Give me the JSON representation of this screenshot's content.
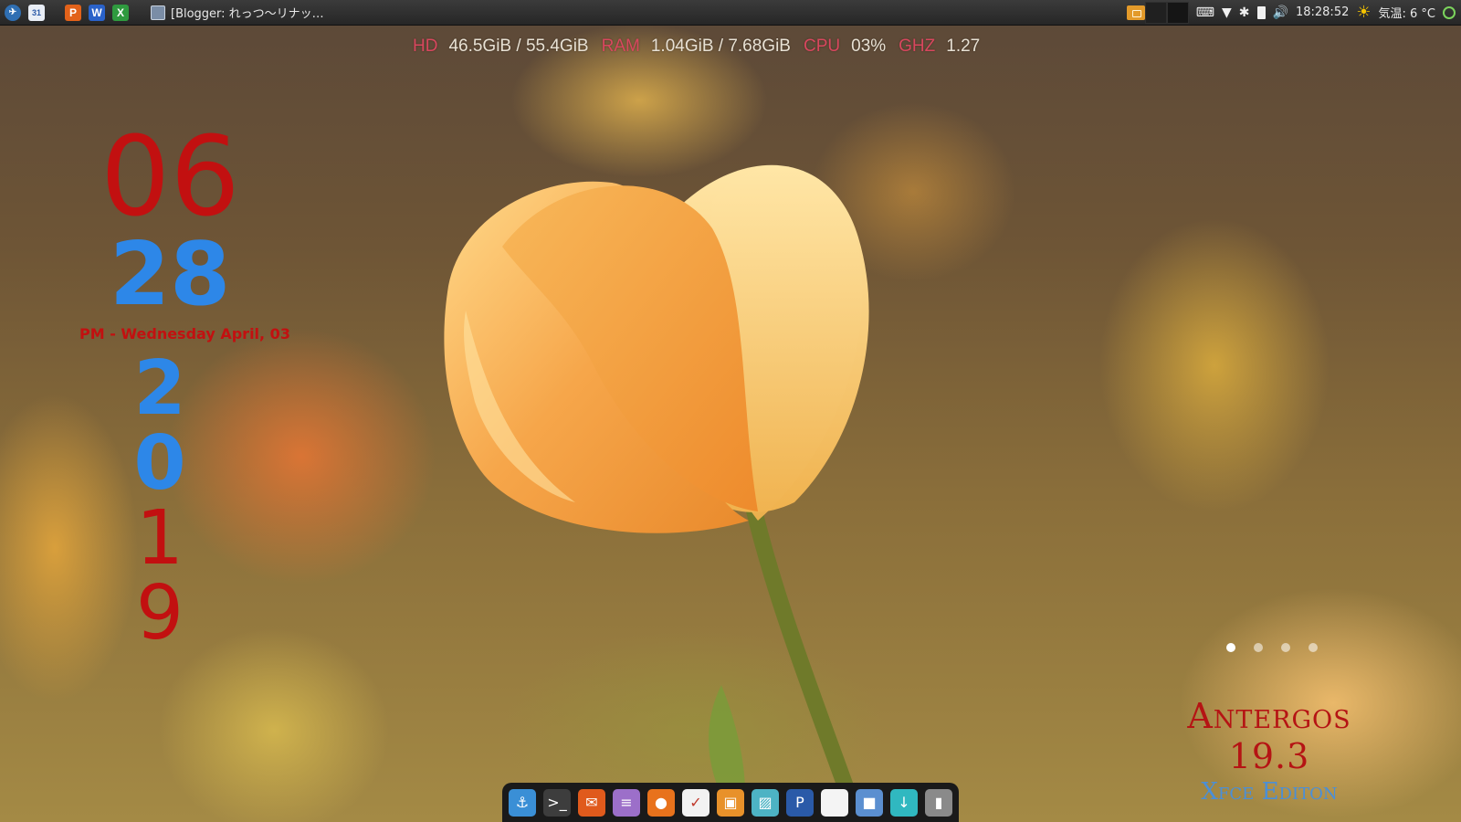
{
  "top_panel": {
    "launchers": [
      {
        "icon": "antergos-menu-icon",
        "glyph": "✈"
      },
      {
        "icon": "calendar-icon",
        "glyph": "31"
      },
      {
        "icon": "wps-presentation-icon",
        "glyph": "P"
      },
      {
        "icon": "wps-writer-icon",
        "glyph": "W"
      },
      {
        "icon": "wps-spreadsheet-icon",
        "glyph": "X"
      }
    ],
    "task_title": "[Blogger: れっつ〜リナッ…",
    "clock": "18:28:52",
    "weather": "気温: 6 °C"
  },
  "system_monitor": {
    "hd_label": "HD",
    "hd_value": "46.5GiB / 55.4GiB",
    "ram_label": "RAM",
    "ram_value": "1.04GiB / 7.68GiB",
    "cpu_label": "CPU",
    "cpu_value": "03%",
    "ghz_label": "GHZ",
    "ghz_value": "1.27"
  },
  "clock_widget": {
    "hour": "06",
    "minute": "28",
    "date_line": "PM - Wednesday April, 03",
    "year_digits": [
      "2",
      "0",
      "1",
      "9"
    ]
  },
  "workspace_dots": {
    "count": 4,
    "active": 0
  },
  "branding": {
    "title": "Antergos 19.3",
    "subtitle": "Xfce Editon"
  },
  "dock": [
    {
      "name": "anchor-icon",
      "glyph": "⚓",
      "color": "#3a8fd6"
    },
    {
      "name": "terminal-icon",
      "glyph": ">_",
      "color": "#3d3d3d"
    },
    {
      "name": "mail-icon",
      "glyph": "✉",
      "color": "#e05a1c"
    },
    {
      "name": "text-editor-icon",
      "glyph": "≡",
      "color": "#9c6fc9"
    },
    {
      "name": "firefox-icon",
      "glyph": "●",
      "color": "#e8721c"
    },
    {
      "name": "task-manager-icon",
      "glyph": "✓",
      "color": "#f2f2f2"
    },
    {
      "name": "screenshot-icon",
      "glyph": "▣",
      "color": "#e8912a"
    },
    {
      "name": "image-viewer-icon",
      "glyph": "▨",
      "color": "#4db3c4"
    },
    {
      "name": "paragraph-icon",
      "glyph": "P",
      "color": "#2a5aa8"
    },
    {
      "name": "document-icon",
      "glyph": "",
      "color": "#f4f4f4"
    },
    {
      "name": "package-icon",
      "glyph": "■",
      "color": "#5b8fd0"
    },
    {
      "name": "software-update-icon",
      "glyph": "↓",
      "color": "#30b8c0"
    },
    {
      "name": "trash-icon",
      "glyph": "▮",
      "color": "#8a8a8a"
    }
  ]
}
